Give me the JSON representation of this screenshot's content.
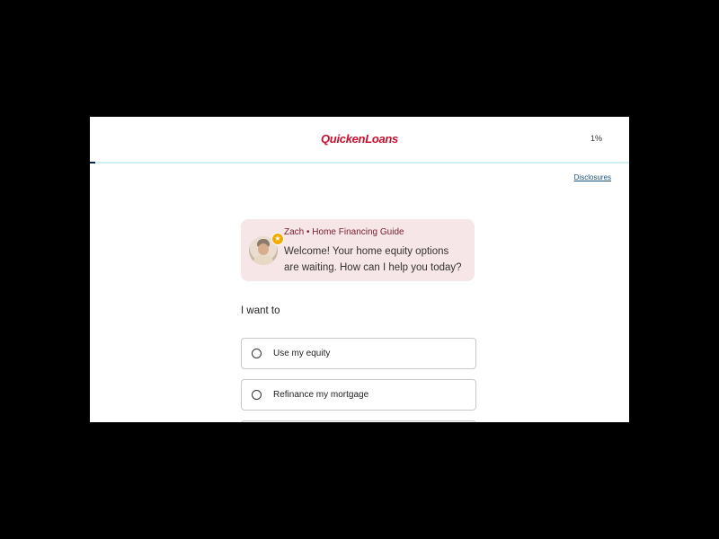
{
  "header": {
    "logo_text": "QuickenLoans",
    "progress_label": "1%",
    "progress_fraction": 0.01
  },
  "disclosures_link": "Disclosures",
  "guide": {
    "name_title": "Zach • Home Financing Guide",
    "message": "Welcome! Your home equity options are waiting. How can I help you today?",
    "badge_icon": "star-icon",
    "badge_glyph": "★"
  },
  "question": {
    "prompt": "I want to",
    "options": [
      {
        "label": "Use my equity",
        "selected": false
      },
      {
        "label": "Refinance my mortgage",
        "selected": false
      }
    ]
  },
  "colors": {
    "brand_red": "#c8102e",
    "bubble_bg": "#f7e6e8",
    "progress_fill": "#0b2a4a",
    "progress_track": "#cfeef0",
    "badge": "#f2a900"
  }
}
